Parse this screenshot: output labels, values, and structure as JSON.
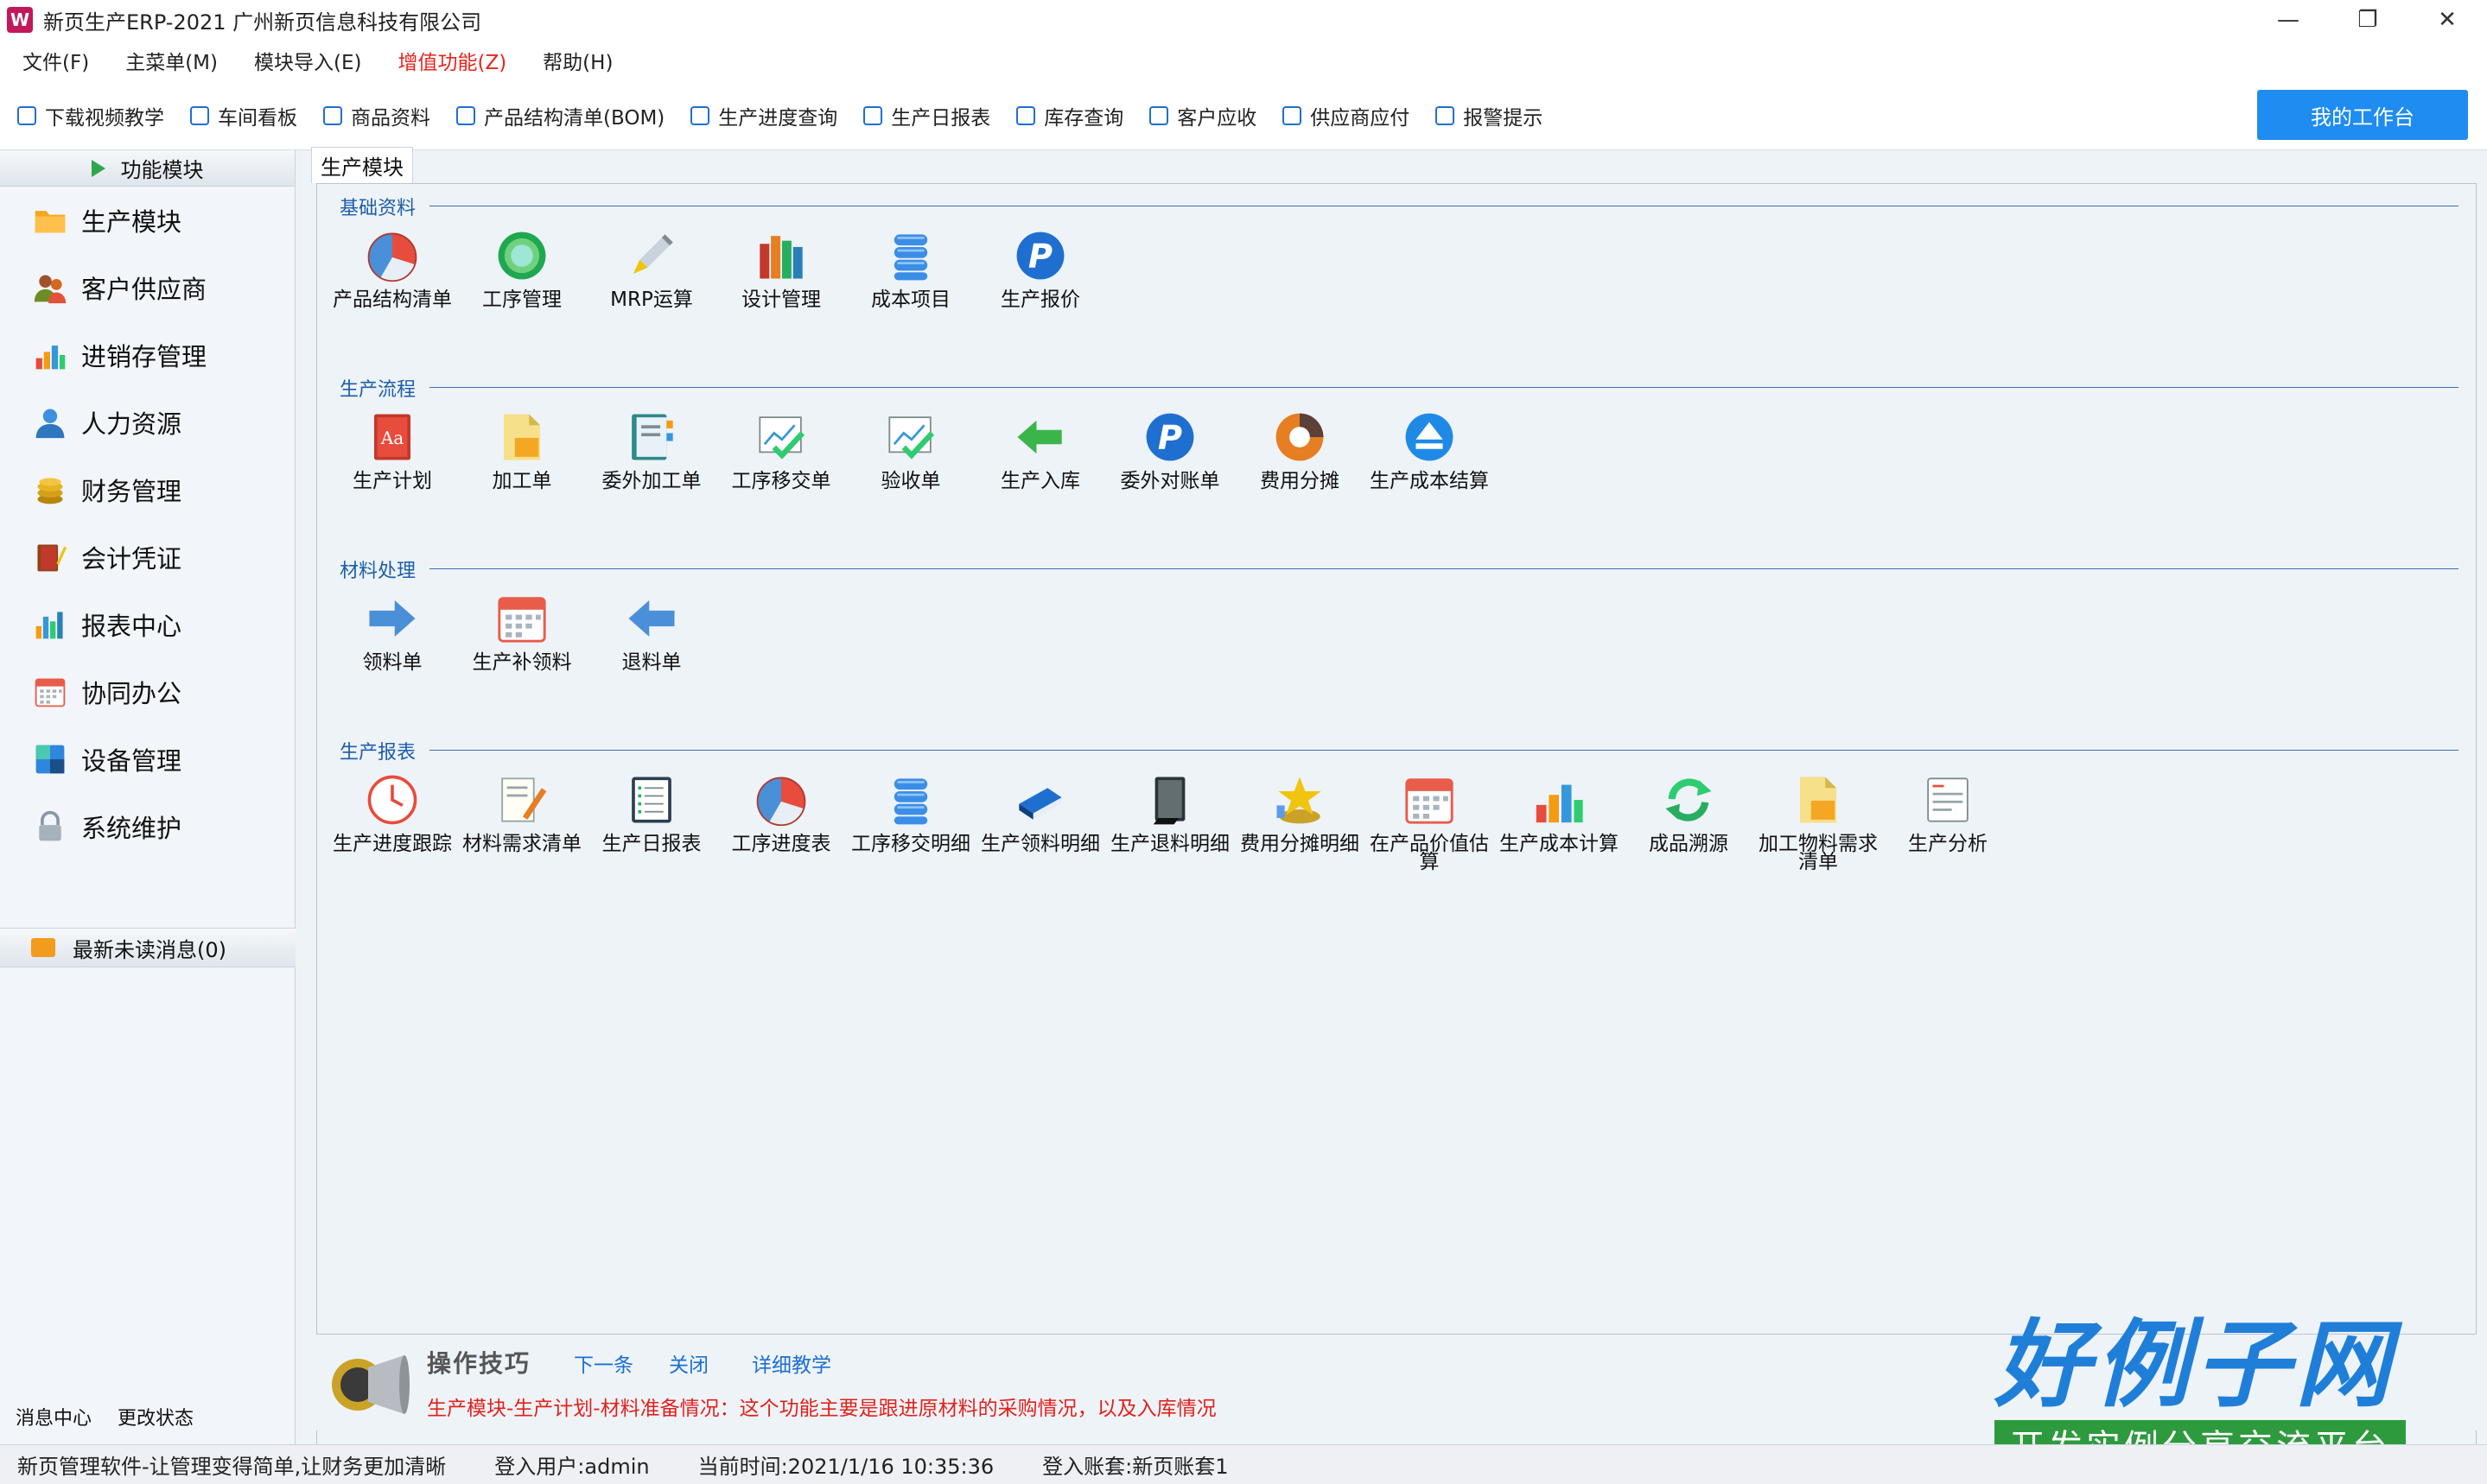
{
  "window": {
    "title": "新页生产ERP-2021 广州新页信息科技有限公司",
    "minimize": "—",
    "maximize": "❐",
    "close": "✕"
  },
  "menu": [
    "文件(F)",
    "主菜单(M)",
    "模块导入(E)",
    "增值功能(Z)",
    "帮助(H)"
  ],
  "quickbar": {
    "items": [
      "下载视频教学",
      "车间看板",
      "商品资料",
      "产品结构清单(BOM)",
      "生产进度查询",
      "生产日报表",
      "库存查询",
      "客户应收",
      "供应商应付",
      "报警提示"
    ],
    "workbench_label": "我的工作台"
  },
  "nav": {
    "header": "功能模块",
    "items": [
      {
        "label": "生产模块",
        "icon": "folder-icon"
      },
      {
        "label": "客户供应商",
        "icon": "users-icon"
      },
      {
        "label": "进销存管理",
        "icon": "bar-chart-icon"
      },
      {
        "label": "人力资源",
        "icon": "person-icon"
      },
      {
        "label": "财务管理",
        "icon": "coins-icon"
      },
      {
        "label": "会计凭证",
        "icon": "book-pen-icon"
      },
      {
        "label": "报表中心",
        "icon": "report-chart-icon"
      },
      {
        "label": "协同办公",
        "icon": "calendar-icon"
      },
      {
        "label": "设备管理",
        "icon": "device-icon"
      },
      {
        "label": "系统维护",
        "icon": "lock-icon"
      }
    ],
    "messages": "最新未读消息(0)",
    "footer": [
      "消息中心",
      "更改状态"
    ]
  },
  "tab": "生产模块",
  "groups": [
    {
      "title": "基础资料",
      "items": [
        {
          "label": "产品结构清单",
          "icon": "pie-icon"
        },
        {
          "label": "工序管理",
          "icon": "circle-icon"
        },
        {
          "label": "MRP运算",
          "icon": "pencil-icon"
        },
        {
          "label": "设计管理",
          "icon": "books-icon"
        },
        {
          "label": "成本项目",
          "icon": "database-icon"
        },
        {
          "label": "生产报价",
          "icon": "p-badge-icon"
        }
      ]
    },
    {
      "title": "生产流程",
      "items": [
        {
          "label": "生产计划",
          "icon": "red-book-icon"
        },
        {
          "label": "加工单",
          "icon": "document-icon"
        },
        {
          "label": "委外加工单",
          "icon": "address-book-icon"
        },
        {
          "label": "工序移交单",
          "icon": "check-chart-icon"
        },
        {
          "label": "验收单",
          "icon": "check-chart-icon"
        },
        {
          "label": "生产入库",
          "icon": "green-arrow-icon"
        },
        {
          "label": "委外对账单",
          "icon": "p-badge-icon"
        },
        {
          "label": "费用分摊",
          "icon": "donut-icon"
        },
        {
          "label": "生产成本结算",
          "icon": "eject-icon"
        }
      ]
    },
    {
      "title": "材料处理",
      "items": [
        {
          "label": "领料单",
          "icon": "arrow-right-icon"
        },
        {
          "label": "生产补领料",
          "icon": "calendar-icon"
        },
        {
          "label": "退料单",
          "icon": "arrow-left-icon"
        }
      ]
    },
    {
      "title": "生产报表",
      "items": [
        {
          "label": "生产进度跟踪",
          "icon": "clock-icon"
        },
        {
          "label": "材料需求清单",
          "icon": "note-pen-icon"
        },
        {
          "label": "生产日报表",
          "icon": "list-icon"
        },
        {
          "label": "工序进度表",
          "icon": "pie-icon"
        },
        {
          "label": "工序移交明细",
          "icon": "database-icon"
        },
        {
          "label": "生产领料明细",
          "icon": "blue-book-icon"
        },
        {
          "label": "生产退料明细",
          "icon": "dark-book-icon"
        },
        {
          "label": "费用分摊明细",
          "icon": "star-icon"
        },
        {
          "label": "在产品价值估算",
          "icon": "calendar-icon"
        },
        {
          "label": "生产成本计算",
          "icon": "bar-chart-icon"
        },
        {
          "label": "成品溯源",
          "icon": "refresh-icon"
        },
        {
          "label": "加工物料需求清单",
          "icon": "document-icon"
        },
        {
          "label": "生产分析",
          "icon": "form-icon"
        }
      ]
    }
  ],
  "tips": {
    "title": "操作技巧",
    "next": "下一条",
    "close": "关闭",
    "detail": "详细教学",
    "text": "生产模块-生产计划-材料准备情况：这个功能主要是跟进原材料的采购情况，以及入库情况"
  },
  "status": [
    "新页管理软件-让管理变得简单,让财务更加清晰",
    "登入用户:admin",
    "当前时间:2021/1/16 10:35:36",
    "登入账套:新页账套1"
  ],
  "brand": {
    "title": "好例子网",
    "subtitle": "开发实例分享交流平台"
  },
  "colors": {
    "accent": "#1e8cf0",
    "highlight_menu": "#e8251e",
    "group_title": "#1c5ea8",
    "tip_text": "#e0221b",
    "brand_green": "#2e9a3e"
  }
}
